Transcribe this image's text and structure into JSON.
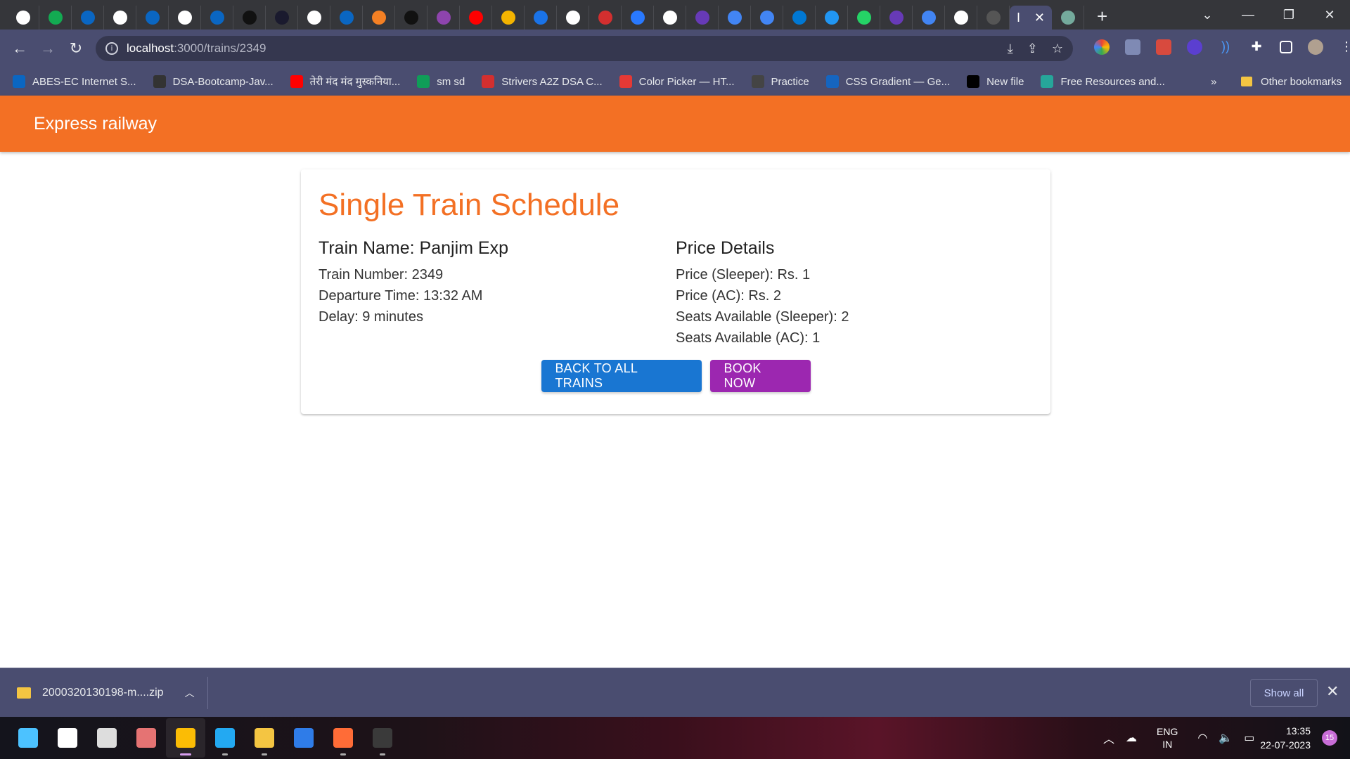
{
  "browser": {
    "tab_favicons": [
      {
        "icon": "github-icon",
        "color": "#ffffff"
      },
      {
        "icon": "mongodb-icon",
        "color": "#13aa52"
      },
      {
        "icon": "s-icon",
        "color": "#0a66c2"
      },
      {
        "icon": "google-icon",
        "color": "#ffffff"
      },
      {
        "icon": "s-icon",
        "color": "#0a66c2"
      },
      {
        "icon": "google-icon",
        "color": "#ffffff"
      },
      {
        "icon": "linkedin-icon",
        "color": "#0a66c2"
      },
      {
        "icon": "square-icon",
        "color": "#111111"
      },
      {
        "icon": "music-icon",
        "color": "#1a1a2e"
      },
      {
        "icon": "chrome-icon",
        "color": "#ffffff"
      },
      {
        "icon": "linkedin-icon",
        "color": "#0a66c2"
      },
      {
        "icon": "stack-icon",
        "color": "#f48024"
      },
      {
        "icon": "nd-icon",
        "color": "#111111"
      },
      {
        "icon": "u-icon",
        "color": "#8e44ad"
      },
      {
        "icon": "youtube-icon",
        "color": "#ff0000"
      },
      {
        "icon": "drive-icon",
        "color": "#f4b400"
      },
      {
        "icon": "hex-icon",
        "color": "#1a73e8"
      },
      {
        "icon": "github-icon",
        "color": "#ffffff"
      },
      {
        "icon": "n-icon",
        "color": "#d32f2f"
      },
      {
        "icon": "diamond-icon",
        "color": "#2979ff"
      },
      {
        "icon": "google-icon",
        "color": "#ffffff"
      },
      {
        "icon": "list-icon",
        "color": "#673ab7"
      },
      {
        "icon": "docs-icon",
        "color": "#4285f4"
      },
      {
        "icon": "lens-icon",
        "color": "#4285f4"
      },
      {
        "icon": "outlook-icon",
        "color": "#0078d4"
      },
      {
        "icon": "teams-icon",
        "color": "#2196f3"
      },
      {
        "icon": "whatsapp-icon",
        "color": "#25d366"
      },
      {
        "icon": "list-icon",
        "color": "#673ab7"
      },
      {
        "icon": "docs-icon",
        "color": "#4285f4"
      },
      {
        "icon": "github-icon",
        "color": "#ffffff"
      },
      {
        "icon": "github-icon",
        "color": "#555555"
      },
      {
        "icon": "chatgpt-icon",
        "color": "#74aa9c"
      }
    ],
    "active_tab_label": "I",
    "url_host": "localhost",
    "url_path": ":3000/trains/2349",
    "bookmarks": [
      {
        "label": "ABES-EC Internet S...",
        "icon": "s-icon",
        "color": "#0a66c2"
      },
      {
        "label": "DSA-Bootcamp-Jav...",
        "icon": "github-icon",
        "color": "#333333"
      },
      {
        "label": "तेरी मंद मंद मुस्कनिया...",
        "icon": "youtube-icon",
        "color": "#ff0000"
      },
      {
        "label": "sm sd",
        "icon": "plus-icon",
        "color": "#0f9d58"
      },
      {
        "label": "Strivers A2Z DSA C...",
        "icon": "tuf-icon",
        "color": "#d32f2f"
      },
      {
        "label": "Color Picker — HT...",
        "icon": "color-picker-icon",
        "color": "#e53935"
      },
      {
        "label": "Practice",
        "icon": "mic-icon",
        "color": "#444444"
      },
      {
        "label": "CSS Gradient — Ge...",
        "icon": "gradient-icon",
        "color": "#1565c0"
      },
      {
        "label": "New file",
        "icon": "circle-icon",
        "color": "#000000"
      },
      {
        "label": "Free Resources and...",
        "icon": "resource-icon",
        "color": "#26a69a"
      }
    ],
    "bookmarks_more": "»",
    "other_bookmarks": "Other bookmarks"
  },
  "app": {
    "title": "Express railway",
    "heading": "Single Train Schedule",
    "left_heading": "Train Name: Panjim Exp",
    "left_lines": [
      "Train Number: 2349",
      "Departure Time: 13:32 AM",
      "Delay: 9 minutes"
    ],
    "right_heading": "Price Details",
    "right_lines": [
      "Price (Sleeper): Rs. 1",
      "Price (AC): Rs. 2",
      "Seats Available (Sleeper): 2",
      "Seats Available (AC): 1"
    ],
    "back_button": "BACK TO ALL TRAINS",
    "book_button": "BOOK NOW",
    "colors": {
      "accent": "#f37024",
      "primary": "#1976d2",
      "secondary": "#9c27b0"
    }
  },
  "downloads": {
    "file_name": "2000320130198-m....zip",
    "show_all": "Show all"
  },
  "taskbar": {
    "apps": [
      {
        "icon": "windows-start-icon",
        "color": "#4cc2ff",
        "active": false,
        "open": false
      },
      {
        "icon": "search-icon",
        "color": "#ffffff",
        "active": false,
        "open": false
      },
      {
        "icon": "task-view-icon",
        "color": "#dddddd",
        "active": false,
        "open": false
      },
      {
        "icon": "notification-app-icon",
        "color": "#e57373",
        "active": false,
        "open": false
      },
      {
        "icon": "chrome-icon",
        "color": "#fbbc05",
        "active": true,
        "open": true
      },
      {
        "icon": "vscode-icon",
        "color": "#23a9f2",
        "active": false,
        "open": true
      },
      {
        "icon": "file-explorer-icon",
        "color": "#f4c542",
        "active": false,
        "open": true
      },
      {
        "icon": "todo-icon",
        "color": "#2f7ce8",
        "active": false,
        "open": false
      },
      {
        "icon": "postman-icon",
        "color": "#ff6c37",
        "active": false,
        "open": true
      },
      {
        "icon": "terminal-icon",
        "color": "#3a3a3a",
        "active": false,
        "open": true
      }
    ],
    "lang_line1": "ENG",
    "lang_line2": "IN",
    "time": "13:35",
    "date": "22-07-2023",
    "notification_count": "15"
  }
}
